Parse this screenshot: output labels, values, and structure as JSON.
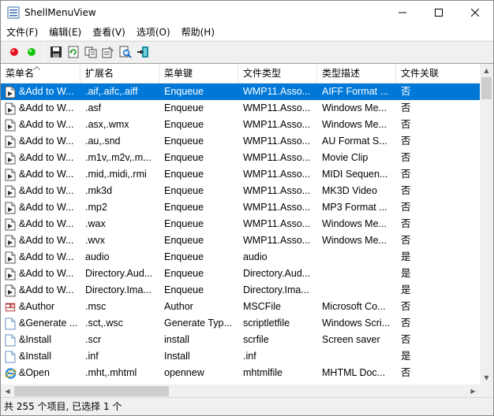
{
  "window": {
    "title": "ShellMenuView"
  },
  "menu": [
    "文件(F)",
    "编辑(E)",
    "查看(V)",
    "选项(O)",
    "帮助(H)"
  ],
  "toolbar": [
    "enable-icon",
    "disable-icon",
    "save-icon",
    "refresh-icon",
    "copy-icon",
    "properties-icon",
    "find-icon",
    "exit-icon"
  ],
  "columns": [
    "菜单名",
    "扩展名",
    "菜单键",
    "文件类型",
    "类型描述",
    "文件关联"
  ],
  "rows": [
    {
      "icon": "media-icon",
      "cells": [
        "&Add to W...",
        ".aif,.aifc,.aiff",
        "Enqueue",
        "WMP11.Asso...",
        "AIFF Format ...",
        "否"
      ],
      "selected": true
    },
    {
      "icon": "media-icon",
      "cells": [
        "&Add to W...",
        ".asf",
        "Enqueue",
        "WMP11.Asso...",
        "Windows Me...",
        "否"
      ]
    },
    {
      "icon": "media-icon",
      "cells": [
        "&Add to W...",
        ".asx,.wmx",
        "Enqueue",
        "WMP11.Asso...",
        "Windows Me...",
        "否"
      ]
    },
    {
      "icon": "media-icon",
      "cells": [
        "&Add to W...",
        ".au,.snd",
        "Enqueue",
        "WMP11.Asso...",
        "AU Format S...",
        "否"
      ]
    },
    {
      "icon": "media-icon",
      "cells": [
        "&Add to W...",
        ".m1v,.m2v,.m...",
        "Enqueue",
        "WMP11.Asso...",
        "Movie Clip",
        "否"
      ]
    },
    {
      "icon": "media-icon",
      "cells": [
        "&Add to W...",
        ".mid,.midi,.rmi",
        "Enqueue",
        "WMP11.Asso...",
        "MIDI Sequen...",
        "否"
      ]
    },
    {
      "icon": "media-icon",
      "cells": [
        "&Add to W...",
        ".mk3d",
        "Enqueue",
        "WMP11.Asso...",
        "MK3D Video",
        "否"
      ]
    },
    {
      "icon": "media-icon",
      "cells": [
        "&Add to W...",
        ".mp2",
        "Enqueue",
        "WMP11.Asso...",
        "MP3 Format ...",
        "否"
      ]
    },
    {
      "icon": "media-icon",
      "cells": [
        "&Add to W...",
        ".wax",
        "Enqueue",
        "WMP11.Asso...",
        "Windows Me...",
        "否"
      ]
    },
    {
      "icon": "media-icon",
      "cells": [
        "&Add to W...",
        ".wvx",
        "Enqueue",
        "WMP11.Asso...",
        "Windows Me...",
        "否"
      ]
    },
    {
      "icon": "media-icon",
      "cells": [
        "&Add to W...",
        "audio",
        "Enqueue",
        "audio",
        "",
        "是"
      ]
    },
    {
      "icon": "media-icon",
      "cells": [
        "&Add to W...",
        "Directory.Aud...",
        "Enqueue",
        "Directory.Aud...",
        "",
        "是"
      ]
    },
    {
      "icon": "media-icon",
      "cells": [
        "&Add to W...",
        "Directory.Ima...",
        "Enqueue",
        "Directory.Ima...",
        "",
        "是"
      ]
    },
    {
      "icon": "console-icon",
      "cells": [
        "&Author",
        ".msc",
        "Author",
        "MSCFile",
        "Microsoft Co...",
        "否"
      ]
    },
    {
      "icon": "document-icon",
      "cells": [
        "&Generate ...",
        ".sct,.wsc",
        "Generate Typ...",
        "scriptletfile",
        "Windows Scri...",
        "否"
      ]
    },
    {
      "icon": "document-icon",
      "cells": [
        "&Install",
        ".scr",
        "install",
        "scrfile",
        "Screen saver",
        "否"
      ]
    },
    {
      "icon": "document-icon",
      "cells": [
        "&Install",
        ".inf",
        "Install",
        ".inf",
        "",
        "是"
      ]
    },
    {
      "icon": "ie-icon",
      "cells": [
        "&Open",
        ".mht,.mhtml",
        "opennew",
        "mhtmlfile",
        "MHTML Doc...",
        "否"
      ]
    }
  ],
  "status": "共 255 个项目, 已选择 1 个",
  "colors": {
    "selection": "#0078d7",
    "enable": "#e81123",
    "disable": "#16c60c"
  }
}
